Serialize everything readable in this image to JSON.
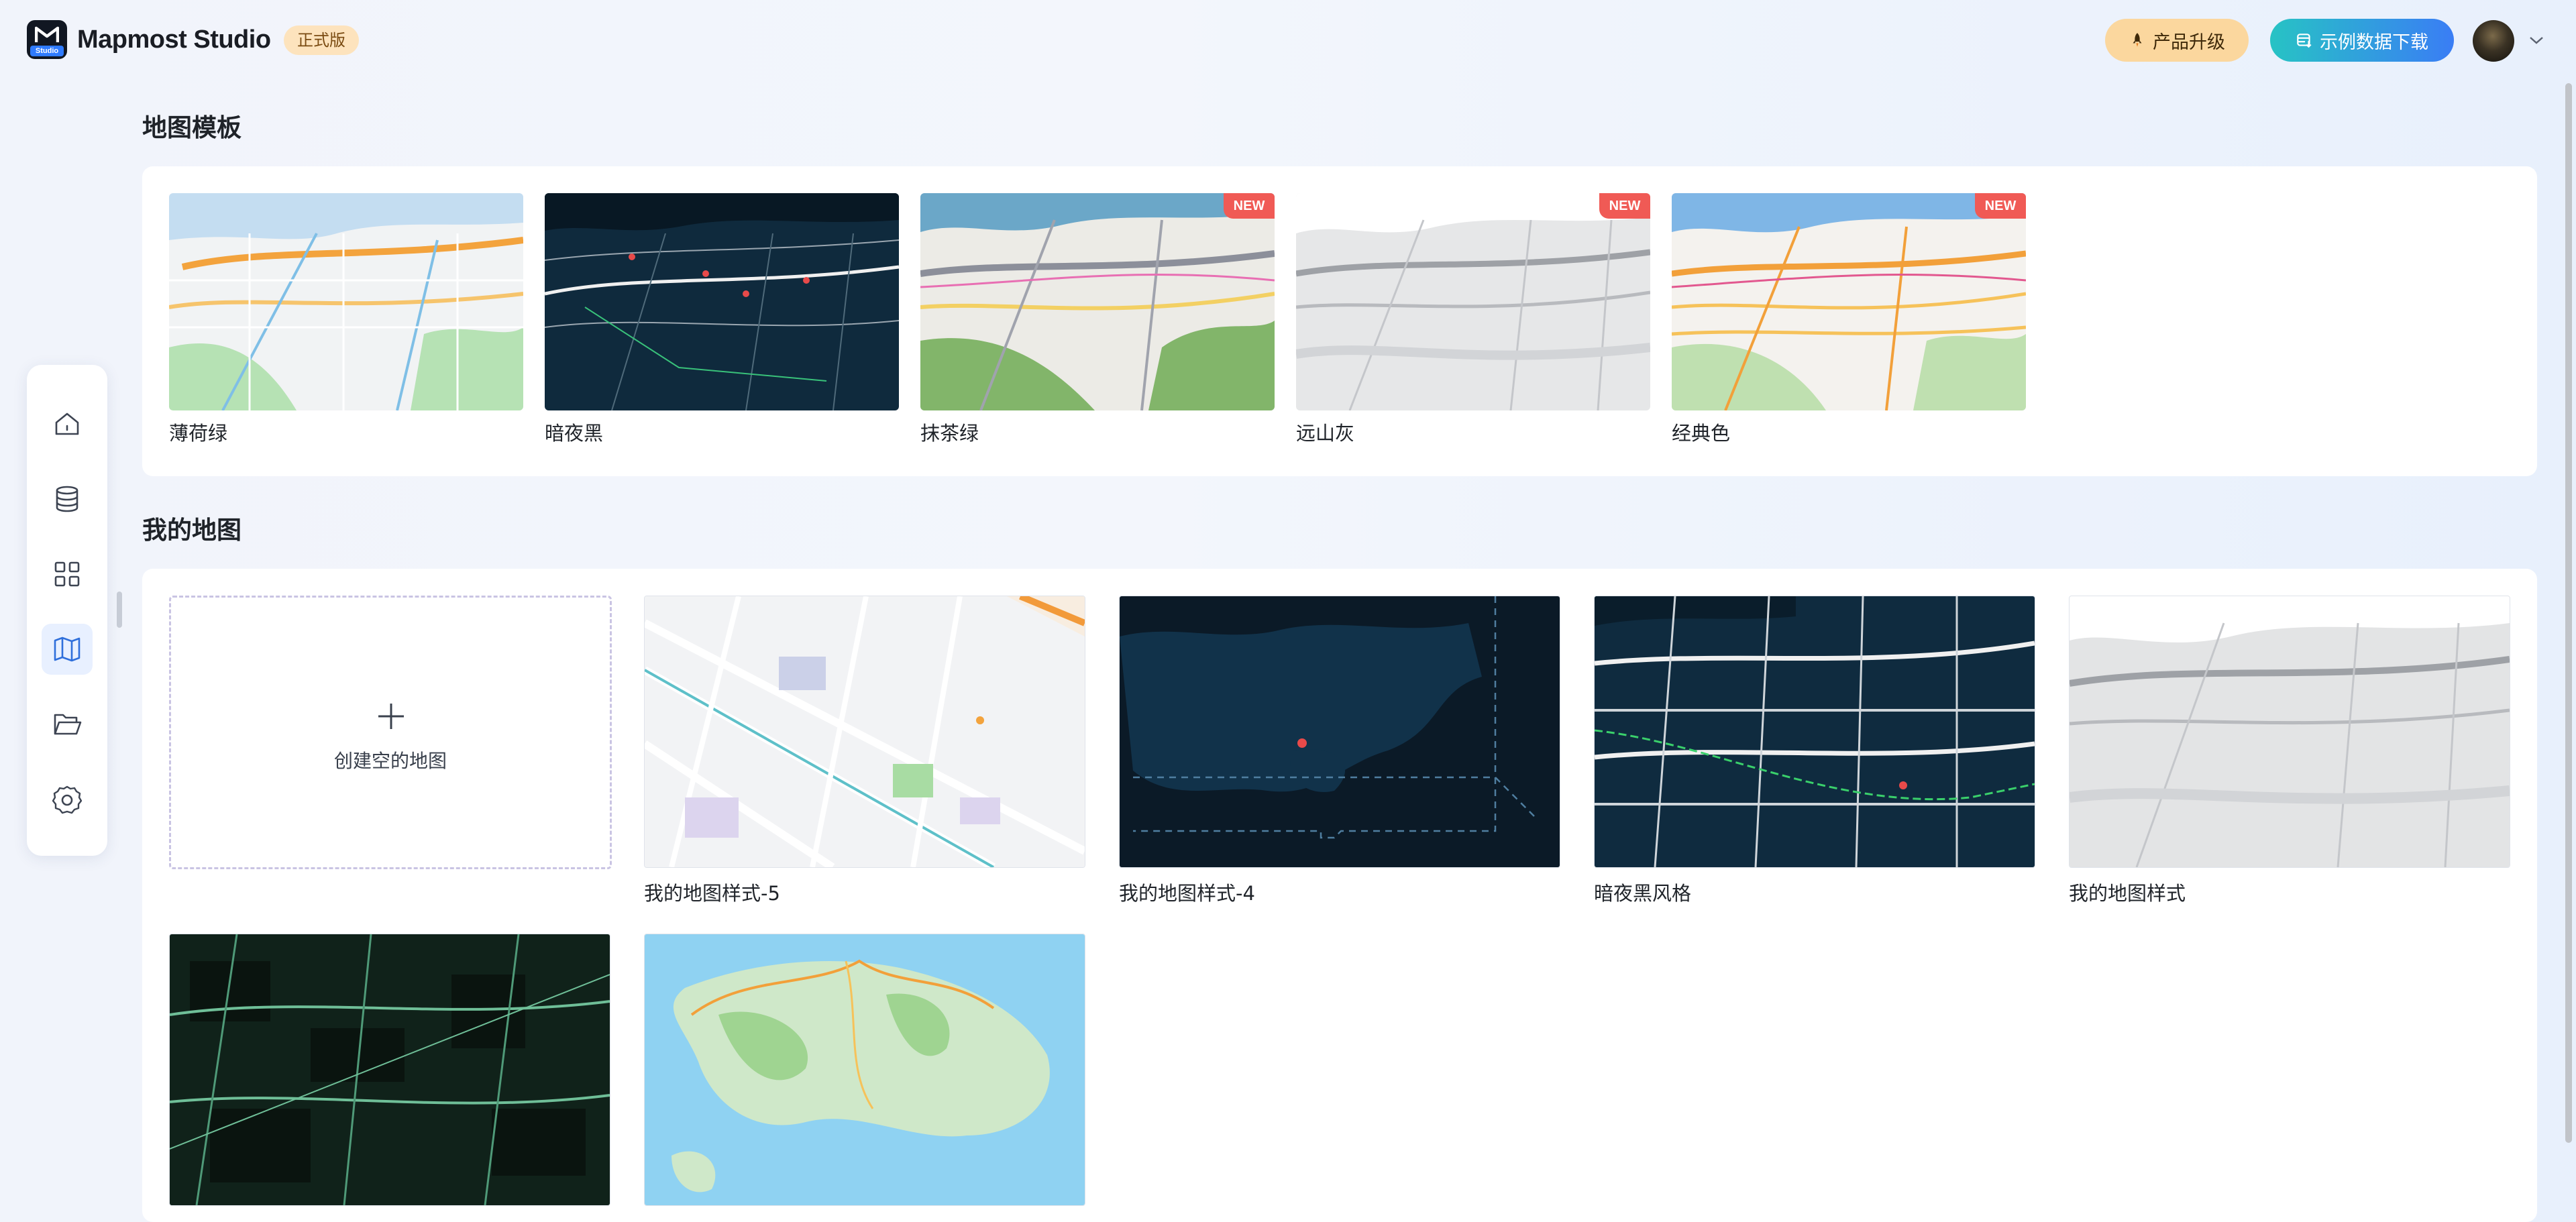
{
  "header": {
    "logo_badge": "Studio",
    "app_title": "Mapmost Studio",
    "edition_badge": "正式版",
    "upgrade_label": "产品升级",
    "download_label": "示例数据下载",
    "upgrade_icon": "rocket-icon",
    "download_icon": "database-download-icon"
  },
  "sidebar": {
    "items": [
      {
        "name": "home",
        "icon": "home-icon"
      },
      {
        "name": "data",
        "icon": "database-icon"
      },
      {
        "name": "apps",
        "icon": "grid-icon"
      },
      {
        "name": "maps",
        "icon": "map-icon",
        "active": true
      },
      {
        "name": "files",
        "icon": "folder-open-icon"
      },
      {
        "name": "settings",
        "icon": "gear-icon"
      }
    ]
  },
  "templates": {
    "title": "地图模板",
    "items": [
      {
        "label": "薄荷绿",
        "new": false,
        "theme": "mint"
      },
      {
        "label": "暗夜黑",
        "new": false,
        "theme": "dark"
      },
      {
        "label": "抹茶绿",
        "new": true,
        "theme": "matcha"
      },
      {
        "label": "远山灰",
        "new": true,
        "theme": "gray"
      },
      {
        "label": "经典色",
        "new": true,
        "theme": "classic"
      }
    ],
    "new_badge": "NEW"
  },
  "my_maps": {
    "title": "我的地图",
    "create_label": "创建空的地图",
    "items": [
      {
        "label": "我的地图样式-5",
        "theme": "light-street"
      },
      {
        "label": "我的地图样式-4",
        "theme": "dark-region"
      },
      {
        "label": "暗夜黑风格",
        "theme": "dark-street"
      },
      {
        "label": "我的地图样式",
        "theme": "gray"
      },
      {
        "label": "",
        "theme": "green-dark"
      },
      {
        "label": "",
        "theme": "island"
      }
    ]
  },
  "colors": {
    "accent": "#2f7bff",
    "upgrade_bg": "#fbd79e",
    "download_gradient": [
      "#27c3c4",
      "#3a7df5"
    ],
    "new_badge": "#f05a55"
  }
}
